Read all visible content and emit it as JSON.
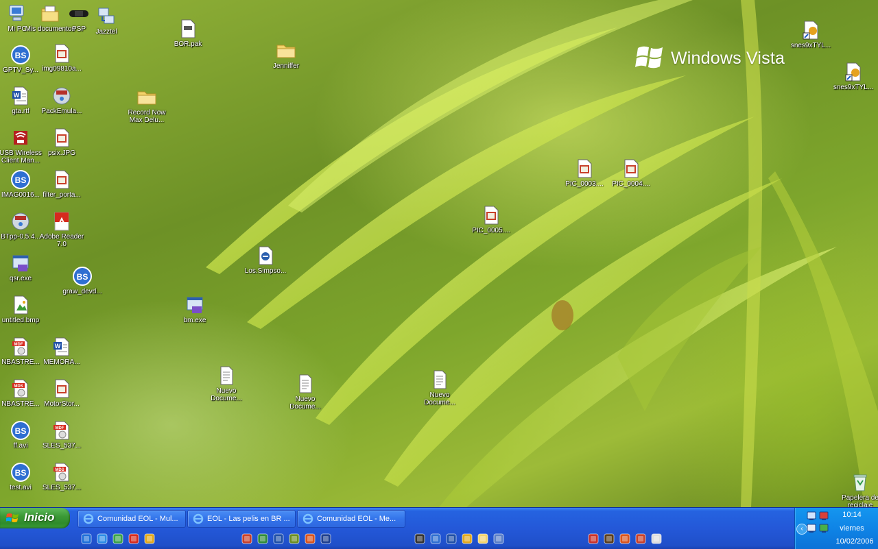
{
  "wallpaper": {
    "brand": "Windows Vista"
  },
  "desktop_icons": [
    {
      "label": "Mi PC",
      "icon": "my-computer-icon"
    },
    {
      "label": "Mis documentos",
      "icon": "my-documents-icon"
    },
    {
      "label": "PSP",
      "icon": "psp-icon"
    },
    {
      "label": "Jazztel",
      "icon": "network-connection-icon"
    },
    {
      "label": "BOR.pak",
      "icon": "file-icon"
    },
    {
      "label": "Jenniffer",
      "icon": "folder-icon"
    },
    {
      "label": "snes9xTYL...",
      "icon": "shortcut-file-icon"
    },
    {
      "label": "snes9xTYL...",
      "icon": "shortcut-file-icon"
    },
    {
      "label": "GPTV_Sy...",
      "icon": "bsplayer-file-icon"
    },
    {
      "label": "img09810a...",
      "icon": "image-file-icon"
    },
    {
      "label": "gta.rtf",
      "icon": "word-document-icon"
    },
    {
      "label": "PackEmula...",
      "icon": "rar-archive-icon"
    },
    {
      "label": "Record Now Max Delu...",
      "icon": "folder-icon"
    },
    {
      "label": "USB Wireless Client Man...",
      "icon": "usb-wireless-icon"
    },
    {
      "label": "psix.JPG",
      "icon": "image-file-icon"
    },
    {
      "label": "IMAG0016...",
      "icon": "bsplayer-file-icon"
    },
    {
      "label": "filter_porta...",
      "icon": "image-file-icon"
    },
    {
      "label": "PIC_0003....",
      "icon": "image-file-icon"
    },
    {
      "label": "PIC_0004....",
      "icon": "image-file-icon"
    },
    {
      "label": "PIC_0005....",
      "icon": "image-file-icon"
    },
    {
      "label": "BTpp-0.5.4...",
      "icon": "rar-archive-icon"
    },
    {
      "label": "Adobe Reader 7.0",
      "icon": "adobe-reader-icon"
    },
    {
      "label": "qsr.exe",
      "icon": "executable-icon"
    },
    {
      "label": "graw_devd...",
      "icon": "bsplayer-file-icon"
    },
    {
      "label": "Los.Simpso...",
      "icon": "document-file-icon"
    },
    {
      "label": "untitled.bmp",
      "icon": "bitmap-file-icon"
    },
    {
      "label": "bm.exe",
      "icon": "executable-icon"
    },
    {
      "label": "NBASTRE...",
      "icon": "mdf-disc-image-icon"
    },
    {
      "label": "MEMORA...",
      "icon": "word-document-icon"
    },
    {
      "label": "NBASTRE...",
      "icon": "mds-disc-image-icon"
    },
    {
      "label": "MotorStor...",
      "icon": "image-file-icon"
    },
    {
      "label": "Nuevo Docume...",
      "icon": "text-document-icon"
    },
    {
      "label": "Nuevo Docume...",
      "icon": "text-document-icon"
    },
    {
      "label": "Nuevo Docume...",
      "icon": "text-document-icon"
    },
    {
      "label": "ff.avi",
      "icon": "bsplayer-file-icon"
    },
    {
      "label": "SLES_537...",
      "icon": "mdf-disc-image-icon"
    },
    {
      "label": "test.avi",
      "icon": "bsplayer-file-icon"
    },
    {
      "label": "SLES_537...",
      "icon": "mds-disc-image-icon"
    },
    {
      "label": "Papelera de reciclaje",
      "icon": "recycle-bin-icon"
    }
  ],
  "taskbar": {
    "start_label": "Inicio",
    "tasks": [
      {
        "label": "Comunidad EOL - Mul..."
      },
      {
        "label": "EOL - Las pelis en BR ..."
      },
      {
        "label": "Comunidad EOL - Me..."
      }
    ],
    "quicklaunch_left": [
      "internet-explorer-icon",
      "outlook-express-icon",
      "messenger-icon",
      "skype-icon",
      "media-player-icon"
    ],
    "quicklaunch_mid": [
      "pdf-tool-icon",
      "excel-icon",
      "application-icon",
      "media-icon",
      "red-app-icon",
      "word-icon"
    ],
    "quicklaunch_mid2": [
      "people-icon",
      "bsplayer-icon",
      "chip-icon",
      "pen-icon",
      "folder-icon",
      "app-icon"
    ],
    "quicklaunch_right": [
      "acrobat-icon",
      "tools-icon",
      "paint-icon",
      "globe-icon",
      "keyboard-icon"
    ]
  },
  "tray": {
    "time": "10:14",
    "day": "viernes",
    "date": "10/02/2006",
    "icons": [
      "network-icon",
      "security-icon",
      "volume-icon",
      "messenger-tray-icon"
    ]
  }
}
